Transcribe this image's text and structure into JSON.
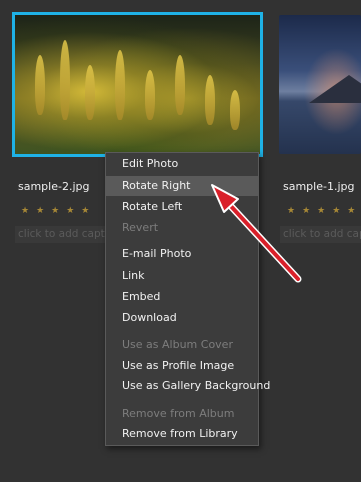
{
  "photos": [
    {
      "filename": "sample-2.jpg",
      "stars": "★★★★★",
      "caption_placeholder": "click to add caption"
    },
    {
      "filename": "sample-1.jpg",
      "stars": "★★★★★",
      "caption_placeholder": "click to add caption"
    }
  ],
  "context_menu": {
    "items": [
      {
        "label": "Edit Photo",
        "enabled": true
      },
      {
        "label": "Rotate Right",
        "enabled": true,
        "highlighted": true
      },
      {
        "label": "Rotate Left",
        "enabled": true
      },
      {
        "label": "Revert",
        "enabled": false
      },
      {
        "label": "E-mail Photo",
        "enabled": true
      },
      {
        "label": "Link",
        "enabled": true
      },
      {
        "label": "Embed",
        "enabled": true
      },
      {
        "label": "Download",
        "enabled": true
      },
      {
        "label": "Use as Album Cover",
        "enabled": false
      },
      {
        "label": "Use as Profile Image",
        "enabled": true
      },
      {
        "label": "Use as Gallery Background",
        "enabled": true
      },
      {
        "label": "Remove from Album",
        "enabled": false
      },
      {
        "label": "Remove from Library",
        "enabled": true
      }
    ]
  },
  "colors": {
    "background": "#323232",
    "selection_border": "#1fb2e6",
    "star": "#a78836",
    "arrow": "#d9202a"
  }
}
